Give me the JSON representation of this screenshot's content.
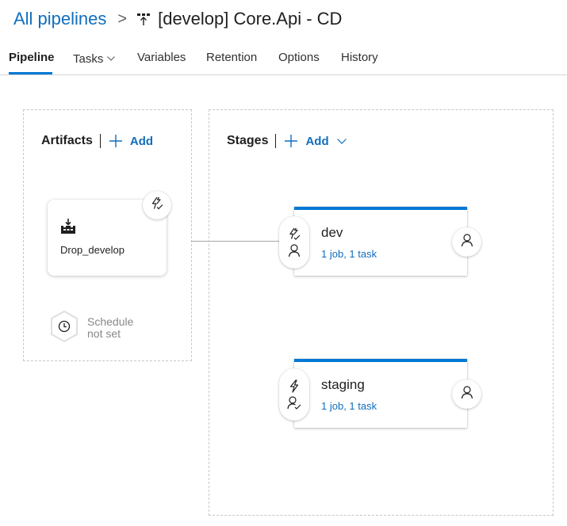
{
  "breadcrumb": {
    "root_label": "All pipelines",
    "separator": ">",
    "pipeline_icon": "release-pipeline-icon",
    "title": "[develop] Core.Api - CD"
  },
  "tabs": [
    {
      "label": "Pipeline",
      "active": true
    },
    {
      "label": "Tasks",
      "active": false,
      "has_dropdown": true
    },
    {
      "label": "Variables",
      "active": false
    },
    {
      "label": "Retention",
      "active": false
    },
    {
      "label": "Options",
      "active": false
    },
    {
      "label": "History",
      "active": false
    }
  ],
  "artifacts": {
    "title": "Artifacts",
    "add_label": "Add",
    "items": [
      {
        "name": "Drop_develop",
        "icon": "build-artifact-icon",
        "trigger_icon": "continuous-deployment-trigger-icon"
      }
    ],
    "schedule": {
      "line1": "Schedule",
      "line2": "not set",
      "icon": "clock-icon"
    }
  },
  "stages": {
    "title": "Stages",
    "add_label": "Add",
    "items": [
      {
        "name": "dev",
        "summary": "1 job, 1 task",
        "trigger_icon": "trigger-icon",
        "pre_approver_icon": "person-icon",
        "post_approver_icon": "person-icon"
      },
      {
        "name": "staging",
        "summary": "1 job, 1 task",
        "trigger_icon": "lightning-icon",
        "pre_approver_icon": "person-check-icon",
        "post_approver_icon": "person-icon"
      }
    ]
  },
  "colors": {
    "accent": "#0078d4",
    "link": "#106ebe"
  }
}
